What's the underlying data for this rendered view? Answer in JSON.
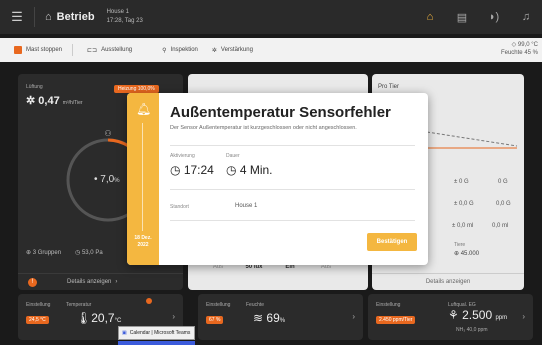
{
  "topbar": {
    "title": "Betrieb",
    "house_name": "House 1",
    "house_date": "17:28, Tag 23"
  },
  "subbar": {
    "stop_label": "Mast stoppen",
    "settings_label": "Ausstellung",
    "inspection_label": "Inspektion",
    "ventilation_label": "Verstärkung",
    "right_top": "◇ 99,0 °C",
    "right_bottom": "Feuchte 45 %"
  },
  "card_left": {
    "small_label": "Lüftung",
    "value": "0,47",
    "unit": "m³/h/Tier",
    "badge": "Heizung 100,0%",
    "temp": "7,0",
    "temp_unit": "%",
    "groups": "3 Gruppen",
    "groups_val": "53,0 Pa",
    "details": "Details anzeigen"
  },
  "card_right": {
    "title": "Pro Tier",
    "rows": [
      {
        "a": "± 0 G",
        "b": "0 G"
      },
      {
        "a": "± 0,0 G",
        "b": "0,0 G"
      },
      {
        "a": "± 0,0 ml",
        "b": "0,0 ml"
      }
    ],
    "tiere_label": "Tiere",
    "tiere_val": "45.000",
    "details": "Details anzeigen"
  },
  "card_mid": {
    "seg": [
      "Aus",
      "50 lux",
      "Ein",
      "Aus"
    ]
  },
  "bottom_cards": [
    {
      "lbl1": "Einstellung",
      "lbl2": "Temperatur",
      "chip": "24,5 °C",
      "val": "20,7",
      "unit": "°C"
    },
    {
      "lbl1": "Einstellung",
      "lbl2": "Feuchte",
      "chip": "67 %",
      "val": "69",
      "unit": "%"
    },
    {
      "lbl1": "Einstellung",
      "lbl2": "Luftqual. EG",
      "chip": "2.450 ppm/Tier",
      "val": "2.500",
      "unit": "ppm",
      "sub": "NH₃ 40,0 ppm"
    }
  ],
  "modal": {
    "title": "Außentemperatur Sensorfehler",
    "desc": "Der Sensor Außentemperatur ist kurzgeschlossen oder nicht angeschlossen.",
    "activation_label": "Aktivierung",
    "activation_time": "17:24",
    "duration_label": "Dauer",
    "duration": "4 Min.",
    "location_label": "Standort",
    "location": "House 1",
    "date_top": "18 Dez.",
    "date_bottom": "2022",
    "confirm": "Bestätigen"
  },
  "tooltip": {
    "label": "Calendar | Microsoft Teams"
  }
}
